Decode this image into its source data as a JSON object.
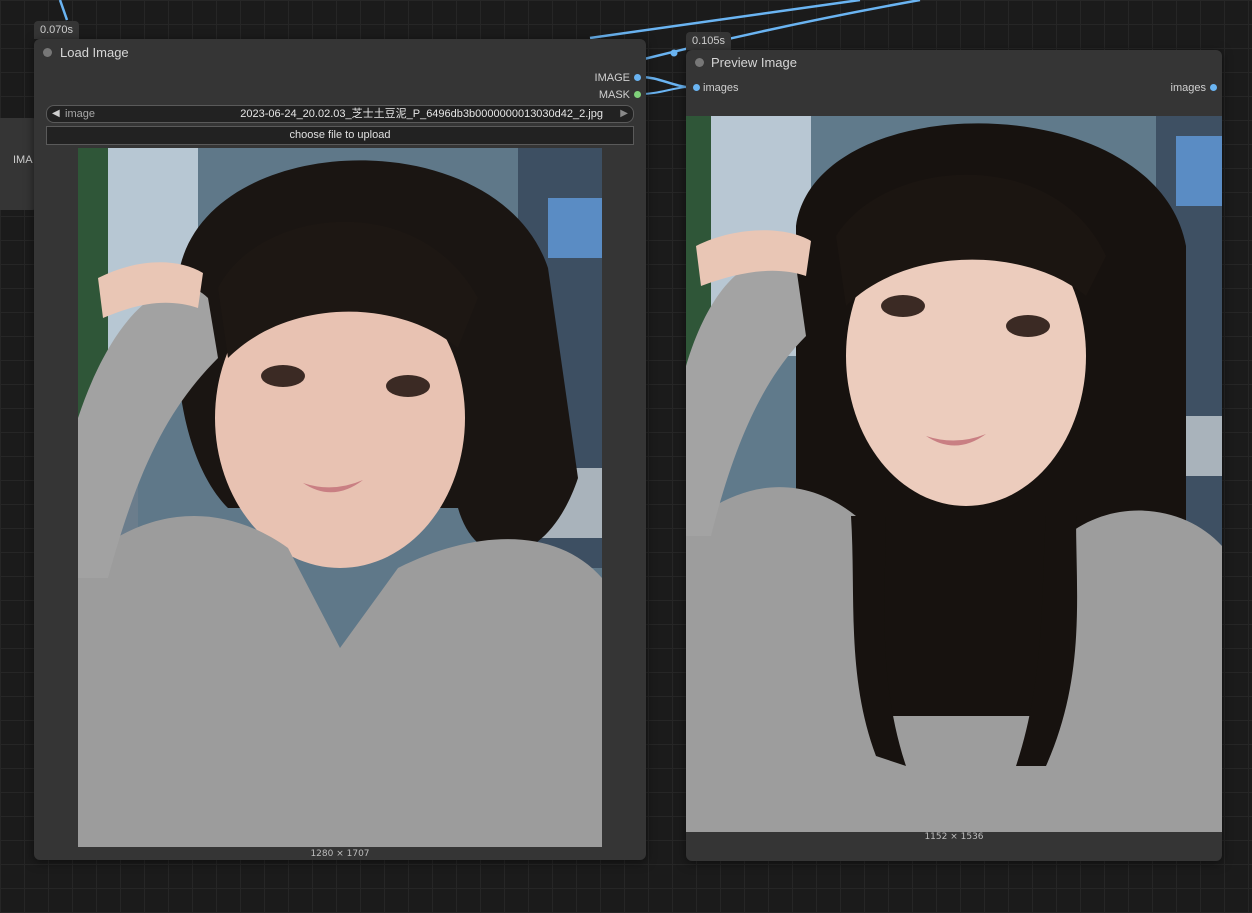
{
  "side_node": {
    "label": "IMA"
  },
  "load_image": {
    "time_badge": "0.070s",
    "title": "Load Image",
    "outputs": [
      "IMAGE",
      "MASK"
    ],
    "image_widget": {
      "label": "image",
      "value": "2023-06-24_20.02.03_芝士土豆泥_P_6496db3b0000000013030d42_2.jpg"
    },
    "upload_button": "choose file to upload",
    "dimensions": "1280 × 1707"
  },
  "preview_image": {
    "time_badge": "0.105s",
    "title": "Preview Image",
    "input": "images",
    "output": "images",
    "dimensions": "1152 × 1536"
  },
  "colors": {
    "canvas": "#1b1b1b",
    "node": "#353535",
    "wire_image": "#6ab4f2",
    "wire_mask": "#7fd07a"
  }
}
